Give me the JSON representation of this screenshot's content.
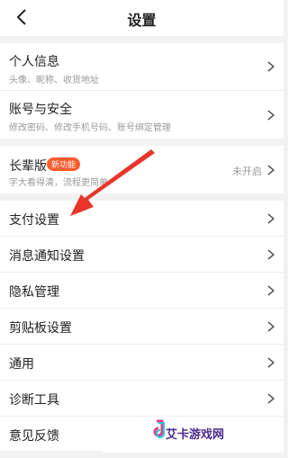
{
  "header": {
    "title": "设置"
  },
  "group1": [
    {
      "title": "个人信息",
      "sub": "头像、昵称、收货地址"
    },
    {
      "title": "账号与安全",
      "sub": "修改密码、修改手机号码、账号绑定管理"
    }
  ],
  "group2": {
    "title": "长辈版",
    "badge": "新功能",
    "sub": "字大看得清，流程更简单",
    "status": "未开启"
  },
  "group3": [
    {
      "title": "支付设置"
    },
    {
      "title": "消息通知设置"
    },
    {
      "title": "隐私管理"
    },
    {
      "title": "剪贴板设置"
    },
    {
      "title": "通用"
    },
    {
      "title": "诊断工具"
    },
    {
      "title": "意见反馈"
    }
  ],
  "watermark": {
    "text": "艾卡游戏网"
  },
  "colors": {
    "accent": "#ff5a2c",
    "arrow": "#e8352b"
  }
}
